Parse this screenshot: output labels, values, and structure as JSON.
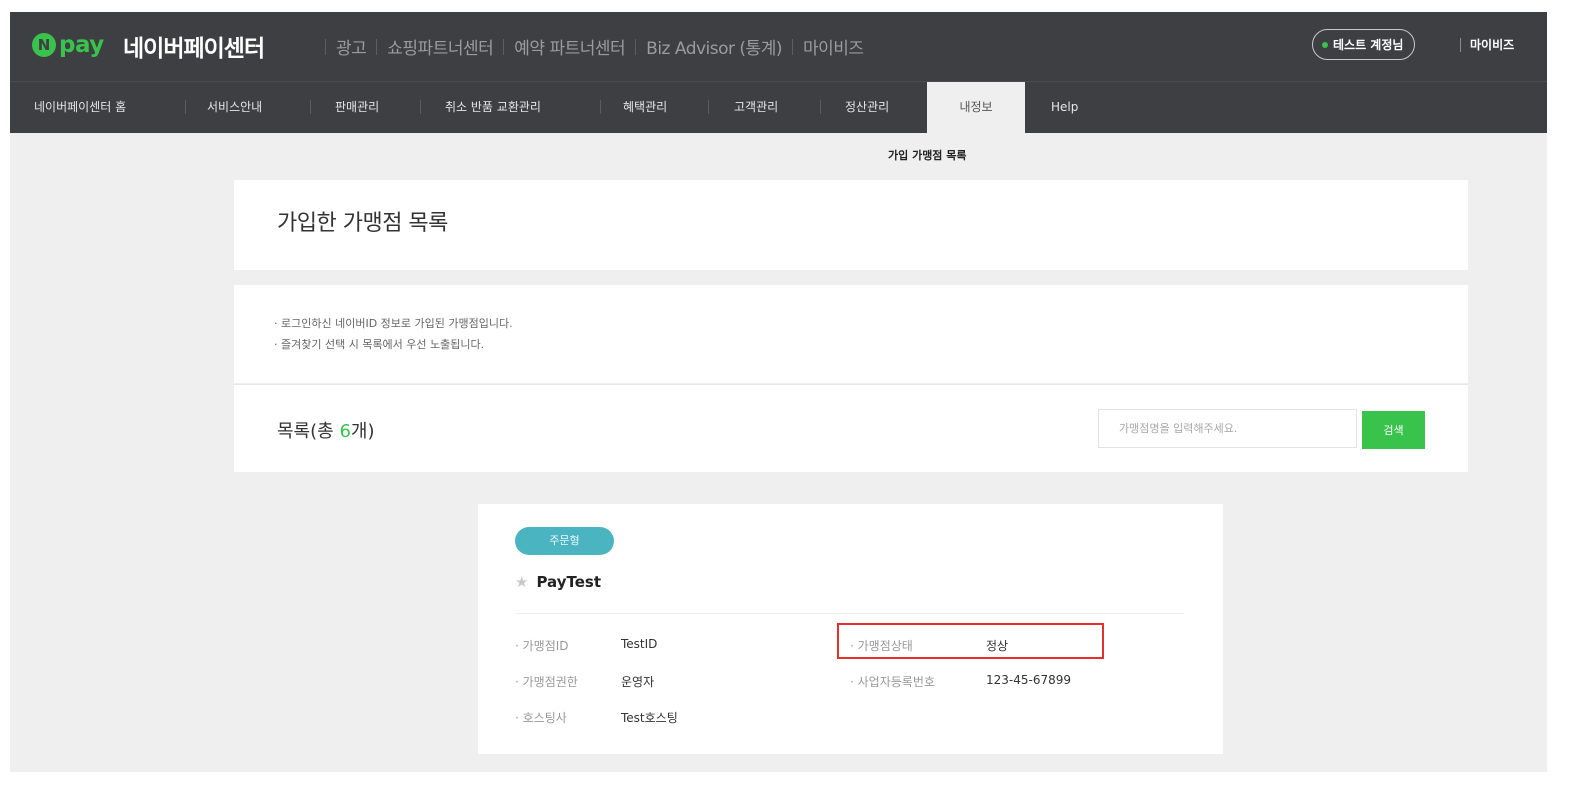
{
  "header": {
    "logo_n": "N",
    "logo_pay": "pay",
    "site_title": "네이버페이센터",
    "links": [
      "광고",
      "쇼핑파트너센터",
      "예약 파트너센터",
      "Biz Advisor (통계)",
      "마이비즈"
    ],
    "test_account": "테스트 계정님",
    "mybiz": "마이비즈",
    "brand_color": "#39c24c"
  },
  "nav": {
    "items": [
      "네이버페이센터 홈",
      "서비스안내",
      "판매관리",
      "취소 반품 교환관리",
      "혜택관리",
      "고객관리",
      "정산관리",
      "내정보",
      "Help"
    ],
    "active": "내정보",
    "subnav": "가입 가맹점 목록"
  },
  "page": {
    "title": "가입한 가맹점 목록",
    "notices": [
      "· 로그인하신 네이버ID 정보로 가입된 가맹점입니다.",
      "· 즐겨찾기 선택 시 목록에서 우선 노출됩니다."
    ]
  },
  "list": {
    "title_prefix": "목록(총 ",
    "count": "6",
    "title_suffix": "개)",
    "search_placeholder": "가맹점명을 입력해주세요.",
    "search_button": "검색"
  },
  "card": {
    "type_badge": "주문형",
    "store_name": "PayTest",
    "left_fields": [
      {
        "label": "· 가맹점ID",
        "value": "TestID"
      },
      {
        "label": "· 가맹점권한",
        "value": "운영자"
      },
      {
        "label": "· 호스팅사",
        "value": "Test호스팅"
      }
    ],
    "right_fields": [
      {
        "label": "· 가맹점상태",
        "value": "정상"
      },
      {
        "label": "· 사업자등록번호",
        "value": "123-45-67899"
      }
    ]
  }
}
